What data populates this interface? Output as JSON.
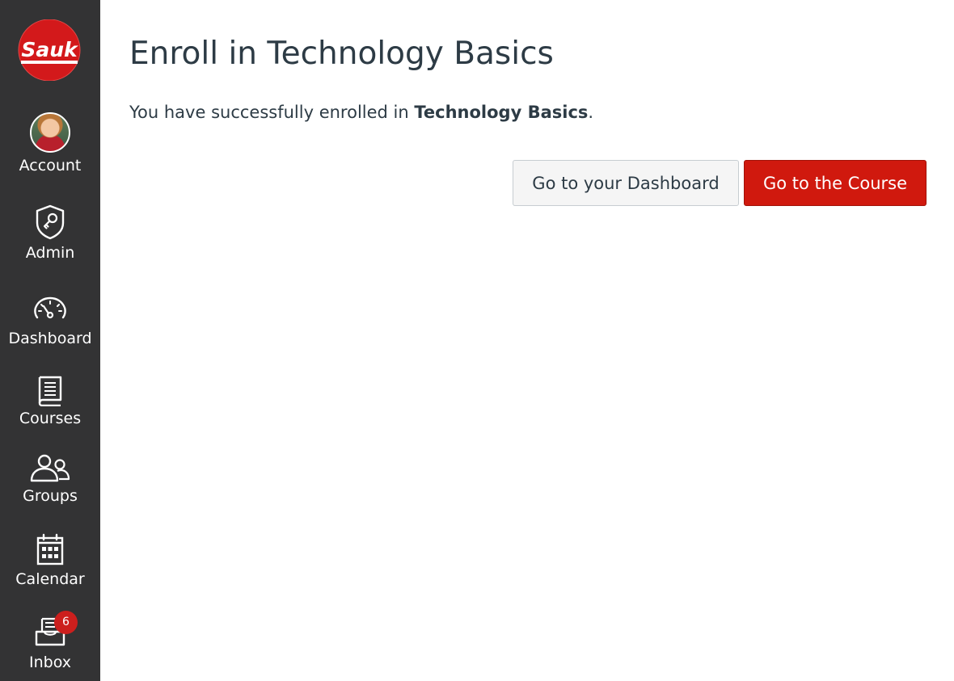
{
  "sidebar": {
    "logo_text": "Sauk",
    "items": [
      {
        "label": "Account",
        "icon": "avatar"
      },
      {
        "label": "Admin",
        "icon": "shield-icon"
      },
      {
        "label": "Dashboard",
        "icon": "speedometer-icon"
      },
      {
        "label": "Courses",
        "icon": "book-icon"
      },
      {
        "label": "Groups",
        "icon": "people-icon"
      },
      {
        "label": "Calendar",
        "icon": "calendar-icon"
      },
      {
        "label": "Inbox",
        "icon": "inbox-icon",
        "badge": "6"
      }
    ]
  },
  "main": {
    "title": "Enroll in Technology Basics",
    "message_prefix": "You have successfully enrolled in ",
    "message_course": "Technology Basics",
    "message_suffix": ".",
    "dashboard_button": "Go to your Dashboard",
    "course_button": "Go to the Course"
  },
  "colors": {
    "sidebar_bg": "#333334",
    "brand_red": "#d0190e",
    "text_dark": "#2d3b45"
  }
}
